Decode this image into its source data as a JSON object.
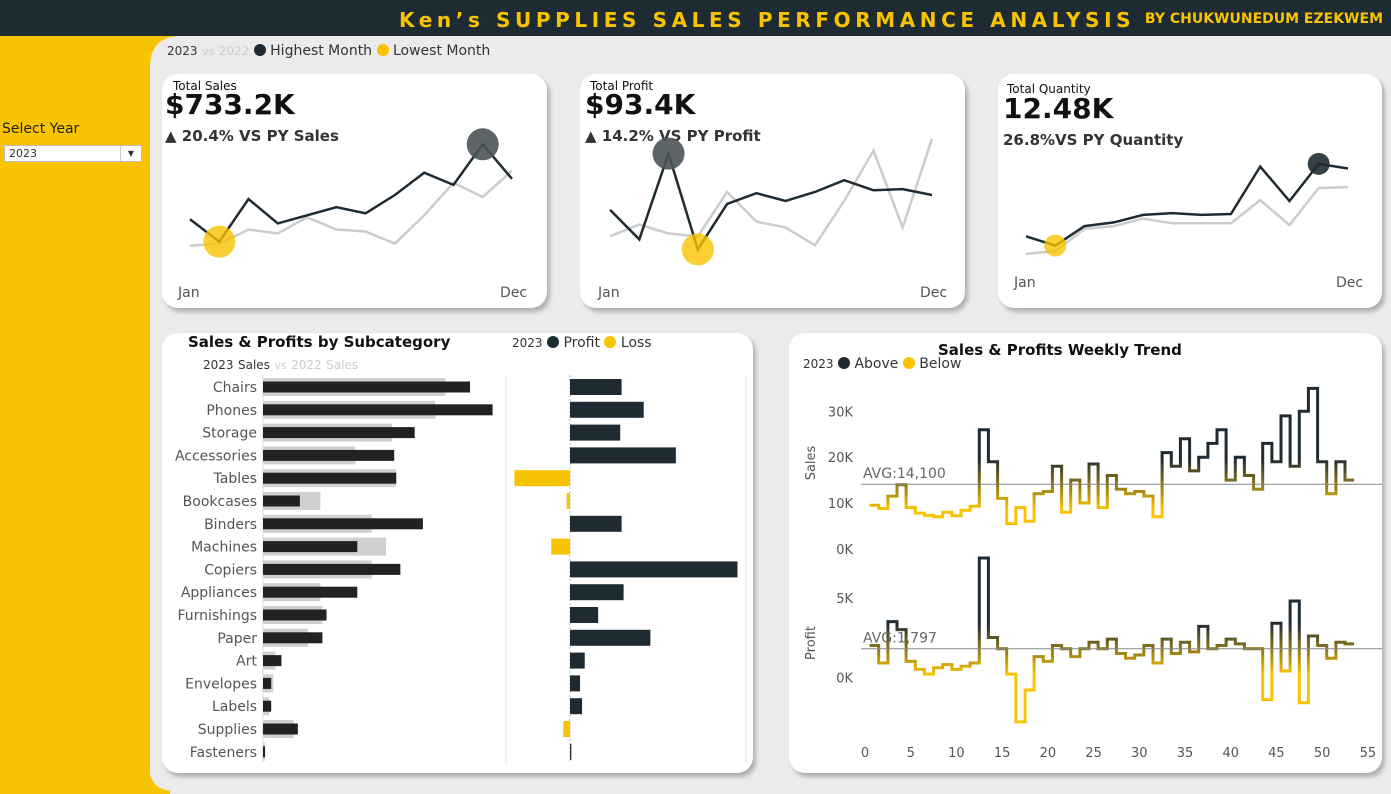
{
  "header": {
    "title": "Ken’s SUPPLIES SALES PERFORMANCE ANALYSIS",
    "author": "BY CHUKWUNEDUM EZEKWEM"
  },
  "sidebar": {
    "select_label": "Select Year",
    "select_value": "2023"
  },
  "colors": {
    "dark": "#1f2b33",
    "yellow": "#f8c300",
    "grey": "#cccccc"
  },
  "kpi_legend": {
    "year": "2023",
    "vs": "vs",
    "prev_year": "2022",
    "highest": "Highest Month",
    "lowest": "Lowest Month"
  },
  "kpis": [
    {
      "label": "Total Sales",
      "value": "$733.2K",
      "delta": "▲ 20.4% VS PY Sales",
      "start": "Jan",
      "end": "Dec"
    },
    {
      "label": "Total Profit",
      "value": "$93.4K",
      "delta": "▲ 14.2% VS PY Profit",
      "start": "Jan",
      "end": "Dec"
    },
    {
      "label": "Total Quantity",
      "value": "12.48K",
      "delta": "26.8%VS PY Quantity",
      "start": "Jan",
      "end": "Dec"
    }
  ],
  "subcategory": {
    "title": "Sales & Profits by Subcategory",
    "legend_year": "2023",
    "legend_sales": "Sales",
    "legend_vs": "vs",
    "legend_prev": "2022",
    "legend_prev_sales": "Sales",
    "profit_year": "2023",
    "profit_label": "Profit",
    "loss_label": "Loss"
  },
  "weekly": {
    "title": "Sales & Profits Weekly Trend",
    "legend_year": "2023",
    "above": "Above",
    "below": "Below",
    "sales_label": "Sales",
    "profit_label": "Profit",
    "sales_avg_label": "AVG:14,100",
    "profit_avg_label": "AVG:1,797"
  },
  "chart_data": [
    {
      "type": "line",
      "title": "Total Sales",
      "x": [
        "Jan",
        "Feb",
        "Mar",
        "Apr",
        "May",
        "Jun",
        "Jul",
        "Aug",
        "Sep",
        "Oct",
        "Nov",
        "Dec"
      ],
      "series": [
        {
          "name": "2023",
          "values": [
            53,
            42,
            63,
            51,
            55,
            59,
            56,
            65,
            76,
            70,
            90,
            73
          ]
        },
        {
          "name": "2022",
          "values": [
            40,
            41,
            48,
            46,
            54,
            48,
            47,
            41,
            55,
            71,
            64,
            77
          ]
        }
      ],
      "ylim": [
        30,
        100
      ]
    },
    {
      "type": "line",
      "title": "Total Profit",
      "x": [
        "Jan",
        "Feb",
        "Mar",
        "Apr",
        "May",
        "Jun",
        "Jul",
        "Aug",
        "Sep",
        "Oct",
        "Nov",
        "Dec"
      ],
      "series": [
        {
          "name": "2023",
          "values": [
            7.5,
            2.5,
            17.0,
            0.8,
            8.5,
            10.3,
            9.0,
            10.5,
            12.5,
            10.8,
            11.0,
            10.0
          ]
        },
        {
          "name": "2022",
          "values": [
            3.0,
            5.0,
            3.5,
            3.0,
            10.5,
            5.5,
            4.5,
            1.5,
            9.0,
            17.5,
            4.5,
            19.5
          ]
        }
      ],
      "ylim": [
        -2,
        22
      ]
    },
    {
      "type": "line",
      "title": "Total Quantity",
      "x": [
        "Jan",
        "Feb",
        "Mar",
        "Apr",
        "May",
        "Jun",
        "Jul",
        "Aug",
        "Sep",
        "Oct",
        "Nov",
        "Dec"
      ],
      "series": [
        {
          "name": "2023",
          "values": [
            720,
            620,
            830,
            870,
            950,
            970,
            950,
            960,
            1470,
            1100,
            1500,
            1450
          ]
        },
        {
          "name": "2022",
          "values": [
            530,
            560,
            800,
            830,
            910,
            860,
            860,
            860,
            1110,
            840,
            1240,
            1250
          ]
        }
      ],
      "ylim": [
        400,
        1800
      ]
    },
    {
      "type": "bar",
      "title": "Sales & Profits by Subcategory",
      "categories": [
        "Chairs",
        "Phones",
        "Storage",
        "Accessories",
        "Tables",
        "Bookcases",
        "Binders",
        "Machines",
        "Copiers",
        "Appliances",
        "Furnishings",
        "Paper",
        "Art",
        "Envelopes",
        "Labels",
        "Supplies",
        "Fasteners"
      ],
      "series": [
        {
          "name": "2023 Sales",
          "values": [
            101,
            112,
            74,
            64,
            65,
            18,
            78,
            46,
            67,
            46,
            31,
            29,
            9,
            4,
            4,
            17,
            1
          ]
        },
        {
          "name": "2022 Sales",
          "values": [
            89,
            84,
            63,
            45,
            65,
            28,
            53,
            60,
            53,
            28,
            29,
            22,
            6,
            5,
            3,
            15,
            1
          ]
        },
        {
          "name": "2023 Profit",
          "values": [
            7.7,
            11.0,
            7.5,
            15.8,
            -8.3,
            -0.5,
            7.7,
            -2.8,
            25.0,
            8.0,
            4.2,
            12.0,
            2.2,
            1.5,
            1.8,
            -1.0,
            0.2
          ]
        }
      ],
      "xlabel": "",
      "ylabel": ""
    },
    {
      "type": "line",
      "title": "Sales & Profits Weekly Trend",
      "x_ticks": [
        0,
        5,
        10,
        15,
        20,
        25,
        30,
        35,
        40,
        45,
        50,
        55
      ],
      "series": [
        {
          "name": "Sales",
          "avg": 14100,
          "ylim": [
            -2000,
            34000
          ],
          "y_ticks": [
            "0K",
            "10K",
            "20K",
            "30K"
          ],
          "values": [
            9500,
            8800,
            11500,
            14000,
            9000,
            7800,
            7300,
            7000,
            8000,
            7200,
            8400,
            9300,
            26000,
            19000,
            11000,
            5500,
            9000,
            6000,
            12000,
            12500,
            18000,
            8000,
            15000,
            10000,
            18500,
            9000,
            16000,
            13000,
            12000,
            12500,
            11500,
            7000,
            21000,
            18000,
            24000,
            17000,
            20000,
            23000,
            26000,
            15000,
            20000,
            16000,
            13000,
            23000,
            19000,
            29000,
            18000,
            30000,
            35000,
            19000,
            12000,
            19000,
            15000
          ]
        },
        {
          "name": "Profit",
          "avg": 1797,
          "ylim": [
            -3500,
            7500
          ],
          "y_ticks": [
            "0K",
            "5K"
          ],
          "values": [
            2000,
            900,
            3500,
            3000,
            1000,
            500,
            200,
            600,
            800,
            500,
            700,
            900,
            7500,
            2500,
            1800,
            200,
            -2800,
            -800,
            1300,
            1000,
            2000,
            1800,
            1300,
            1800,
            2200,
            1800,
            2400,
            1500,
            1200,
            1400,
            2000,
            900,
            2400,
            1500,
            2200,
            1600,
            3200,
            1800,
            2000,
            2400,
            2100,
            1800,
            1800,
            -1400,
            3400,
            400,
            4800,
            -1600,
            2600,
            2000,
            1200,
            2200,
            2100
          ]
        }
      ],
      "xlabel": ""
    }
  ]
}
